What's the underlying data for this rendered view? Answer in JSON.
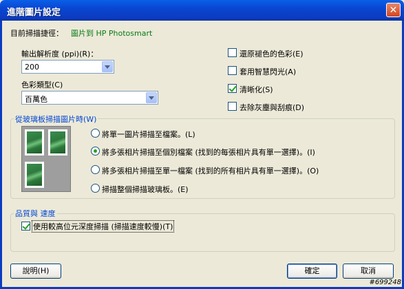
{
  "window": {
    "title": "進階圖片設定",
    "close_glyph": "✕"
  },
  "scan_path": {
    "label": "目前掃描捷徑：",
    "value": "圖片到 HP Photosmart"
  },
  "resolution": {
    "label": "輸出解析度 (ppi)(R)：",
    "value": "200"
  },
  "color_type": {
    "label": "色彩類型(C)",
    "value": "百萬色"
  },
  "options": {
    "restore_faded": {
      "label": "還原褪色的色彩(E)",
      "checked": false
    },
    "adaptive_flash": {
      "label": "套用智慧閃光(A)",
      "checked": false
    },
    "sharpen": {
      "label": "清晰化(S)",
      "checked": true
    },
    "remove_dust": {
      "label": "去除灰塵與刮痕(D)",
      "checked": false
    }
  },
  "glass_group": {
    "title": "從玻璃板掃描圖片時(W)",
    "radios": [
      {
        "label": "將單一圖片掃描至檔案。(L)",
        "selected": false
      },
      {
        "label": "將多張相片掃描至個別檔案 (找到的每張相片具有單一選擇)。(I)",
        "selected": true
      },
      {
        "label": "將多張相片掃描至單一檔案 (找到的所有相片具有單一選擇)。(O)",
        "selected": false
      },
      {
        "label": "掃描整個掃描玻璃板。(E)",
        "selected": false
      }
    ]
  },
  "quality_group": {
    "title": "品質與 速度",
    "high_bit": {
      "label": "使用較高位元深度掃描 (掃描速度較慢)(T)",
      "checked": true
    }
  },
  "buttons": {
    "help": "說明(H)",
    "ok": "確定",
    "cancel": "取消"
  },
  "watermark": "#699248"
}
